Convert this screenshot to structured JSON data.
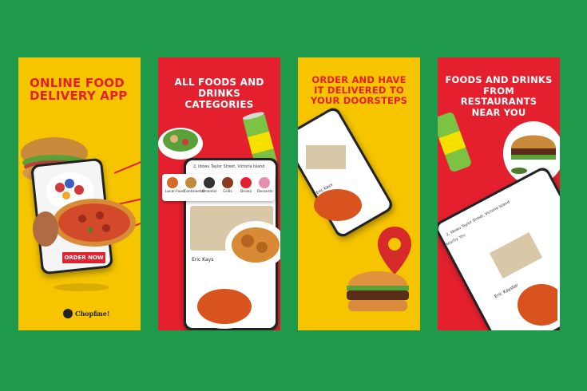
{
  "panels": [
    {
      "headline_line1": "ONLINE FOOD",
      "headline_line2": "DELIVERY APP",
      "button": "ORDER NOW",
      "brand": "Chopfine!"
    },
    {
      "headline_line1": "ALL FOODS AND",
      "headline_line2": "DRINKS CATEGORIES",
      "address": "2, Idowu Taylor Street, Victoria Island",
      "categories": [
        "Local Food",
        "Continental",
        "Oriental",
        "Grills",
        "Drinks",
        "Desserts"
      ],
      "restaurant": "Eric Kays"
    },
    {
      "headline_line1": "ORDER AND HAVE",
      "headline_line2": "IT DELIVERED TO",
      "headline_line3": "YOUR DOORSTEPS",
      "restaurant": "Eric Kays"
    },
    {
      "headline_line1": "FOODS AND DRINKS",
      "headline_line2": "FROM RESTAURANTS",
      "headline_line3": "NEAR YOU",
      "address": "2, Idowu Taylor Street, Victoria Island",
      "section": "Nearby You",
      "restaurant": "Eric Kaystar"
    }
  ],
  "colors": {
    "background": "#1f9a4a",
    "yellow": "#f6c500",
    "red": "#e5202e"
  }
}
